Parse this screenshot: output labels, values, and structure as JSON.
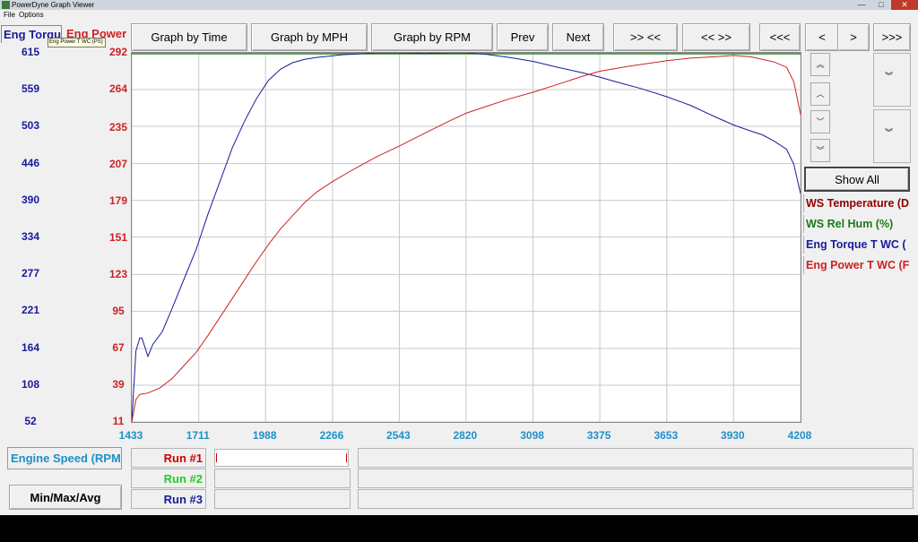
{
  "window": {
    "title": "PowerDyne Graph Viewer",
    "minimize_glyph": "—",
    "maximize_glyph": "□",
    "close_glyph": "✕"
  },
  "menu": {
    "items": [
      "File",
      "Options"
    ]
  },
  "tabs": {
    "left": "Eng Torque",
    "right": "Eng Power"
  },
  "tooltip": "Eng Power T WC (PS)",
  "toolbar": {
    "graph_by_time": "Graph by Time",
    "graph_by_mph": "Graph by MPH",
    "graph_by_rpm": "Graph by RPM",
    "prev": "Prev",
    "next": "Next",
    "zoom_in": ">> <<",
    "zoom_out": "<< >>",
    "first": "<<<",
    "left": "<",
    "right": ">",
    "last": ">>>"
  },
  "side": {
    "show_all": "Show All",
    "scroll_icons": [
      "double-chevron-up-icon",
      "chevron-up-icon",
      "chevron-down-icon",
      "double-chevron-down-icon"
    ]
  },
  "legend": [
    {
      "label": "WS Temperature (D",
      "color": "#8b0000"
    },
    {
      "label": "WS Rel Hum (%)",
      "color": "#1a7a1a"
    },
    {
      "label": "Eng Torque T WC (",
      "color": "#1a1a9a"
    },
    {
      "label": "Eng Power T WC (F",
      "color": "#cc2222"
    }
  ],
  "bottom": {
    "x_channel": "Engine Speed (RPM",
    "min_max_avg": "Min/Max/Avg",
    "runs": [
      {
        "label": "Run #1",
        "color": "#cc0000"
      },
      {
        "label": "Run #2",
        "color": "#22cc22"
      },
      {
        "label": "Run #3",
        "color": "#1a1a9a"
      }
    ]
  },
  "chart_data": {
    "type": "line",
    "x_ticks": [
      1433,
      1711,
      1988,
      2266,
      2543,
      2820,
      3098,
      3375,
      3653,
      3930,
      4208
    ],
    "y_left_ticks": [
      615,
      559,
      503,
      446,
      390,
      334,
      277,
      221,
      164,
      108,
      52
    ],
    "y_right_ticks": [
      292,
      264,
      235,
      207,
      179,
      151,
      123,
      95,
      67,
      39,
      11
    ],
    "xlim": [
      1433,
      4208
    ],
    "ylim_left": [
      52,
      615
    ],
    "ylim_right": [
      11,
      292
    ],
    "grid": true,
    "colors": {
      "torque": "#1a1a9a",
      "power": "#cc2222",
      "axis_x": "#1e90c8",
      "axis_left": "#1a1a9a",
      "axis_right": "#cc2222",
      "top_line": "#2a8a2a"
    },
    "series": [
      {
        "name": "Eng Torque T WC",
        "color": "#1a1a9a",
        "axis": "left",
        "x": [
          1433,
          1450,
          1466,
          1475,
          1500,
          1520,
          1560,
          1600,
          1650,
          1700,
          1750,
          1800,
          1850,
          1900,
          1950,
          2000,
          2050,
          2100,
          2150,
          2200,
          2250,
          2300,
          2350,
          2400,
          2450,
          2500,
          2543,
          2650,
          2750,
          2820,
          2900,
          3000,
          3098,
          3200,
          3300,
          3375,
          3450,
          3550,
          3653,
          3750,
          3850,
          3930,
          4000,
          4050,
          4100,
          4150,
          4180,
          4208
        ],
        "y": [
          52,
          160,
          180,
          180,
          152,
          170,
          190,
          225,
          270,
          315,
          370,
          420,
          470,
          510,
          545,
          573,
          590,
          600,
          605,
          608,
          610,
          612,
          613,
          614,
          615,
          615,
          615,
          614,
          615,
          615,
          613,
          608,
          602,
          593,
          585,
          578,
          570,
          560,
          548,
          535,
          518,
          505,
          496,
          490,
          480,
          468,
          445,
          400
        ]
      },
      {
        "name": "Eng Power T WC",
        "color": "#cc2222",
        "axis": "right",
        "x": [
          1433,
          1450,
          1466,
          1500,
          1550,
          1600,
          1650,
          1700,
          1750,
          1800,
          1850,
          1900,
          1950,
          2000,
          2050,
          2100,
          2150,
          2200,
          2266,
          2350,
          2450,
          2543,
          2650,
          2750,
          2820,
          2900,
          3000,
          3098,
          3200,
          3300,
          3375,
          3500,
          3653,
          3750,
          3850,
          3930,
          4000,
          4050,
          4100,
          4150,
          4180,
          4208
        ],
        "y": [
          11,
          28,
          32,
          33,
          37,
          44,
          54,
          64,
          77,
          91,
          105,
          119,
          133,
          146,
          158,
          168,
          178,
          186,
          194,
          203,
          213,
          221,
          231,
          240,
          246,
          251,
          257,
          262,
          268,
          274,
          278,
          282,
          286,
          288,
          289,
          290,
          289,
          287,
          285,
          281,
          270,
          245
        ]
      }
    ]
  }
}
